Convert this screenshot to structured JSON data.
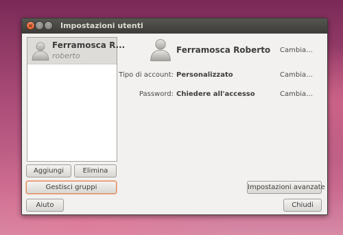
{
  "window": {
    "title": "Impostazioni utenti",
    "close_glyph": "×",
    "min_glyph": "–",
    "max_glyph": "□"
  },
  "user_list": {
    "items": [
      {
        "name": "Ferramosca R...",
        "login": "roberto",
        "selected": true,
        "icon": "user-avatar-icon"
      }
    ]
  },
  "list_buttons": {
    "add": "Aggiungi",
    "delete": "Elimina",
    "manage_groups": "Gestisci gruppi"
  },
  "details": {
    "icon": "user-avatar-icon",
    "full_name": "Ferramosca Roberto",
    "name_change": "Cambia…",
    "account_type_label": "Tipo di account:",
    "account_type_value": "Personalizzato",
    "account_type_change": "Cambia…",
    "password_label": "Password:",
    "password_value": "Chiedere all'accesso",
    "password_change": "Cambia…",
    "advanced_button": "Impostazioni avanzate"
  },
  "footer": {
    "help": "Aiuto",
    "close": "Chiudi"
  },
  "colors": {
    "titlebar": "#3c3b37",
    "window_bg": "#f2f1f0",
    "selection": "#dedcd8",
    "close_button": "#e05a2b",
    "focus_ring": "#e08a5f"
  }
}
